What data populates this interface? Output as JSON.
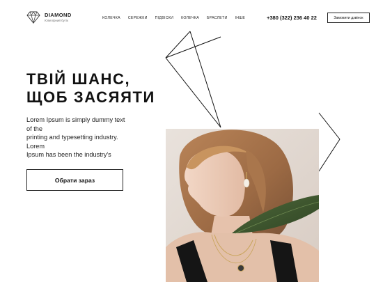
{
  "brand": {
    "name": "DIAMOND",
    "subtitle": "Ювелірний бутік",
    "logo_icon": "diamond-icon"
  },
  "nav": {
    "items": [
      {
        "label": "КОЛЕЧКА"
      },
      {
        "label": "СЕРЕЖКИ"
      },
      {
        "label": "ПІДВІСКИ"
      },
      {
        "label": "КОЛЕЧКА"
      },
      {
        "label": "БРАСЛЕТИ"
      },
      {
        "label": "ІНШЕ"
      }
    ]
  },
  "contact": {
    "phone": "+380 (322) 236 40 22",
    "callback_label": "Замовити дзвінок"
  },
  "hero": {
    "title_line1": "ТВІЙ ШАНС,",
    "title_line2": "ЩОБ ЗАСЯЯТИ",
    "description_lines": [
      "Lorem Ipsum is simply dummy text",
      "of the",
      "printing and typesetting industry.",
      "Lorem",
      "Ipsum has been the industry's"
    ],
    "cta_label": "Обрати зараз",
    "image": "woman-with-earring-photo"
  },
  "colors": {
    "text": "#111111",
    "background": "#ffffff",
    "border": "#222222",
    "photo_background": "#e6ddd7"
  }
}
